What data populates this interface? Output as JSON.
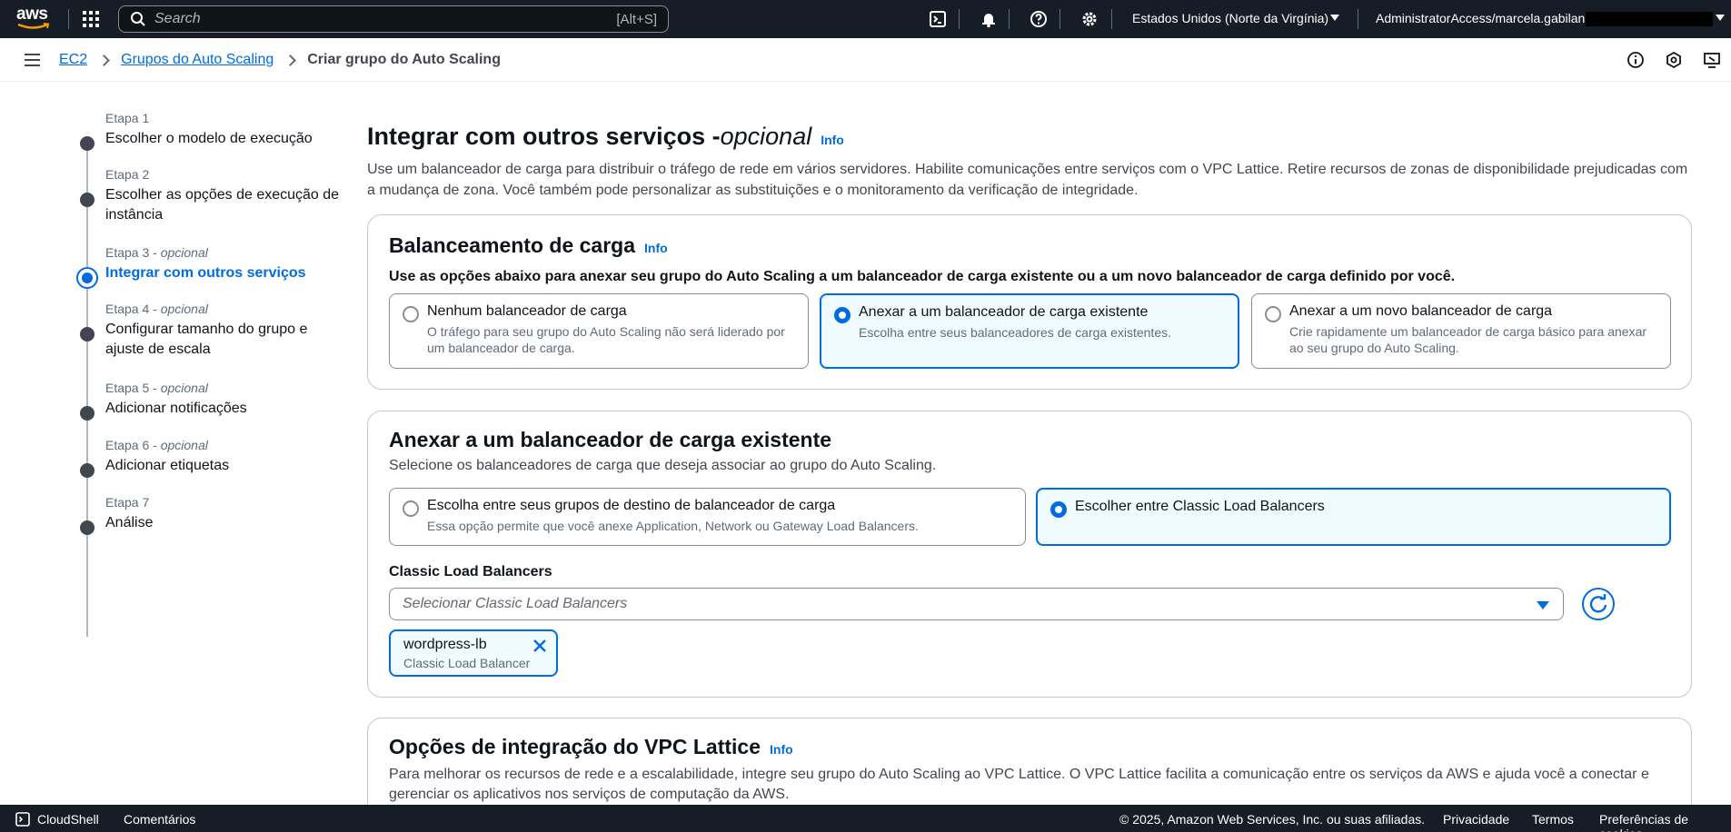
{
  "topnav": {
    "logo_text": "aws",
    "search_placeholder": "Search",
    "search_shortcut": "[Alt+S]",
    "region": "Estados Unidos (Norte da Virgínia)",
    "account": "AdministratorAccess/marcela.gabilan"
  },
  "breadcrumb": {
    "items": [
      "EC2",
      "Grupos do Auto Scaling"
    ],
    "current": "Criar grupo do Auto Scaling"
  },
  "steps": [
    {
      "label": "Etapa 1",
      "optional": "",
      "title": "Escolher o modelo de execução"
    },
    {
      "label": "Etapa 2",
      "optional": "",
      "title": "Escolher as opções de execução de instância"
    },
    {
      "label": "Etapa 3 - ",
      "optional": "opcional",
      "title": "Integrar com outros serviços"
    },
    {
      "label": "Etapa 4 - ",
      "optional": "opcional",
      "title": "Configurar tamanho do grupo e ajuste de escala"
    },
    {
      "label": "Etapa 5 - ",
      "optional": "opcional",
      "title": "Adicionar notificações"
    },
    {
      "label": "Etapa 6 - ",
      "optional": "opcional",
      "title": "Adicionar etiquetas"
    },
    {
      "label": "Etapa 7",
      "optional": "",
      "title": "Análise"
    }
  ],
  "page": {
    "title": "Integrar com outros serviços - ",
    "title_optional": "opcional",
    "info": "Info",
    "description": "Use um balanceador de carga para distribuir o tráfego de rede em vários servidores. Habilite comunicações entre serviços com o VPC Lattice. Retire recursos de zonas de disponibilidade prejudicadas com a mudança de zona. Você também pode personalizar as substituições e o monitoramento da verificação de integridade."
  },
  "lb_card": {
    "title": "Balanceamento de carga",
    "info": "Info",
    "instructions": "Use as opções abaixo para anexar seu grupo do Auto Scaling a um balanceador de carga existente ou a um novo balanceador de carga definido por você.",
    "options": [
      {
        "title": "Nenhum balanceador de carga",
        "desc": "O tráfego para seu grupo do Auto Scaling não será liderado por um balanceador de carga."
      },
      {
        "title": "Anexar a um balanceador de carga existente",
        "desc": "Escolha entre seus balanceadores de carga existentes."
      },
      {
        "title": "Anexar a um novo balanceador de carga",
        "desc": "Crie rapidamente um balanceador de carga básico para anexar ao seu grupo do Auto Scaling."
      }
    ],
    "selected": 1
  },
  "attach_card": {
    "title": "Anexar a um balanceador de carga existente",
    "subtitle": "Selecione os balanceadores de carga que deseja associar ao grupo do Auto Scaling.",
    "options": [
      {
        "title": "Escolha entre seus grupos de destino de balanceador de carga",
        "desc": "Essa opção permite que você anexe Application, Network ou Gateway Load Balancers."
      },
      {
        "title": "Escolher entre Classic Load Balancers",
        "desc": ""
      }
    ],
    "selected": 1,
    "field_label": "Classic Load Balancers",
    "select_placeholder": "Selecionar Classic Load Balancers",
    "token": {
      "name": "wordpress-lb",
      "type": "Classic Load Balancer"
    }
  },
  "vpc_card": {
    "title": "Opções de integração do VPC Lattice",
    "info": "Info",
    "description": "Para melhorar os recursos de rede e a escalabilidade, integre seu grupo do Auto Scaling ao VPC Lattice. O VPC Lattice facilita a comunicação entre os serviços da AWS e ajuda você a conectar e gerenciar os aplicativos nos serviços de computação da AWS."
  },
  "footer": {
    "cloudshell": "CloudShell",
    "feedback": "Comentários",
    "copyright": "© 2025, Amazon Web Services, Inc. ou suas afiliadas.",
    "privacy": "Privacidade",
    "terms": "Termos",
    "cookies": "Preferências de cookies"
  },
  "colors": {
    "accent": "#006ce0",
    "nav_bg": "#161d26",
    "selected_bg": "#f0fbff"
  }
}
